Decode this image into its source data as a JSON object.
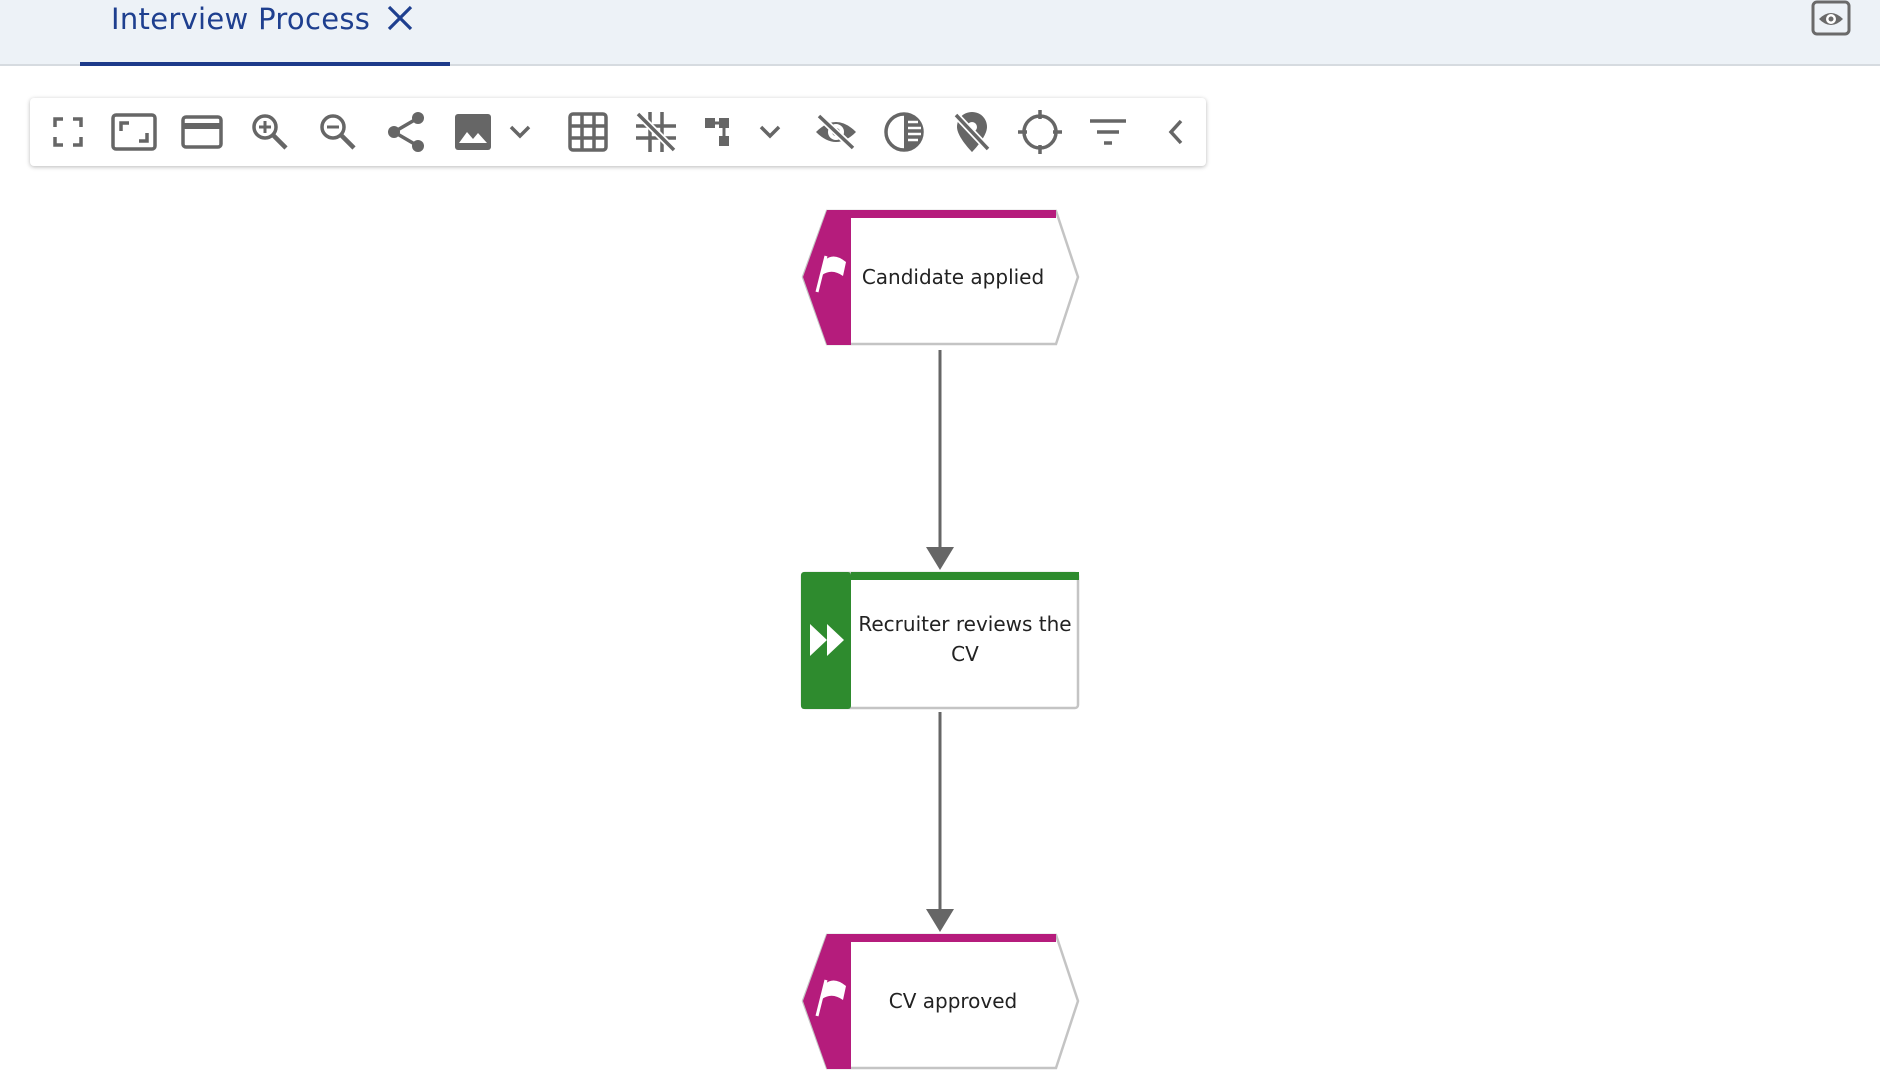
{
  "tab": {
    "title": "Interview Process",
    "close_icon": "close-icon",
    "active_underline_color": "#1d3a8a"
  },
  "header": {
    "preview_icon": "eye-icon"
  },
  "toolbar": {
    "items": [
      {
        "name": "fullscreen-icon"
      },
      {
        "name": "fit-to-screen-icon"
      },
      {
        "name": "card-view-icon"
      },
      {
        "name": "zoom-in-icon"
      },
      {
        "name": "zoom-out-icon"
      },
      {
        "name": "share-icon"
      },
      {
        "name": "image-icon"
      },
      {
        "name": "chevron-down-icon"
      },
      {
        "name": "grid-icon"
      },
      {
        "name": "snap-off-icon"
      },
      {
        "name": "layout-icon"
      },
      {
        "name": "chevron-down-icon"
      },
      {
        "name": "eye-off-icon"
      },
      {
        "name": "contrast-icon"
      },
      {
        "name": "location-off-icon"
      },
      {
        "name": "crosshair-icon"
      },
      {
        "name": "filter-icon"
      },
      {
        "name": "chevron-left-icon"
      }
    ]
  },
  "diagram": {
    "colors": {
      "event": "#b51c7c",
      "function": "#2e8b2e",
      "connector": "#6b6b6b"
    },
    "nodes": [
      {
        "type": "event",
        "label": "Candidate applied",
        "icon": "flag-icon"
      },
      {
        "type": "function",
        "label_line1": "Recruiter reviews the",
        "label_line2": "CV",
        "icon": "fast-forward-icon"
      },
      {
        "type": "event",
        "label": "CV approved",
        "icon": "flag-icon"
      }
    ]
  }
}
